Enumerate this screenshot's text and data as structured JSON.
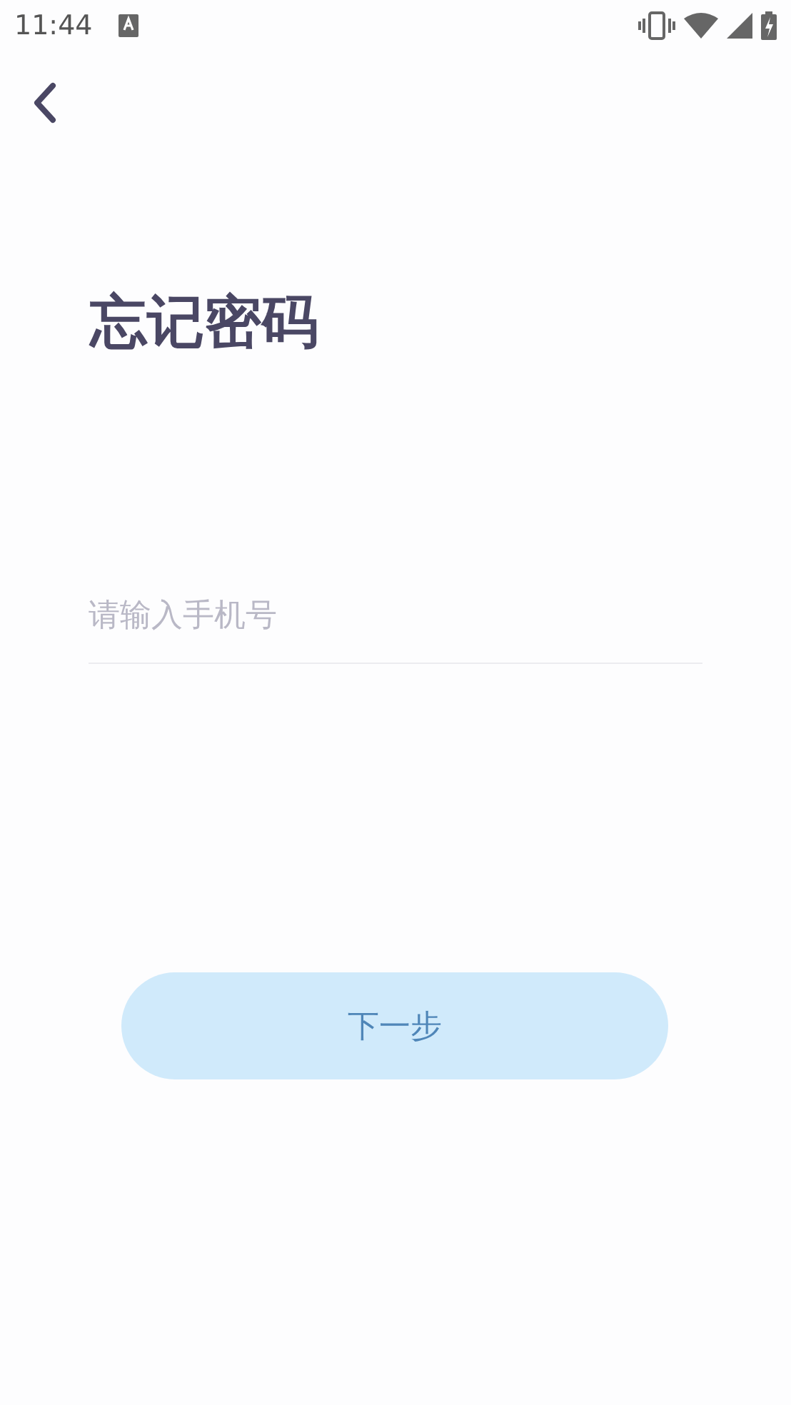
{
  "status_bar": {
    "time": "11:44"
  },
  "title": "忘记密码",
  "phone_field": {
    "placeholder": "请输入手机号"
  },
  "next_button": {
    "label": "下一步",
    "disabled": true
  }
}
